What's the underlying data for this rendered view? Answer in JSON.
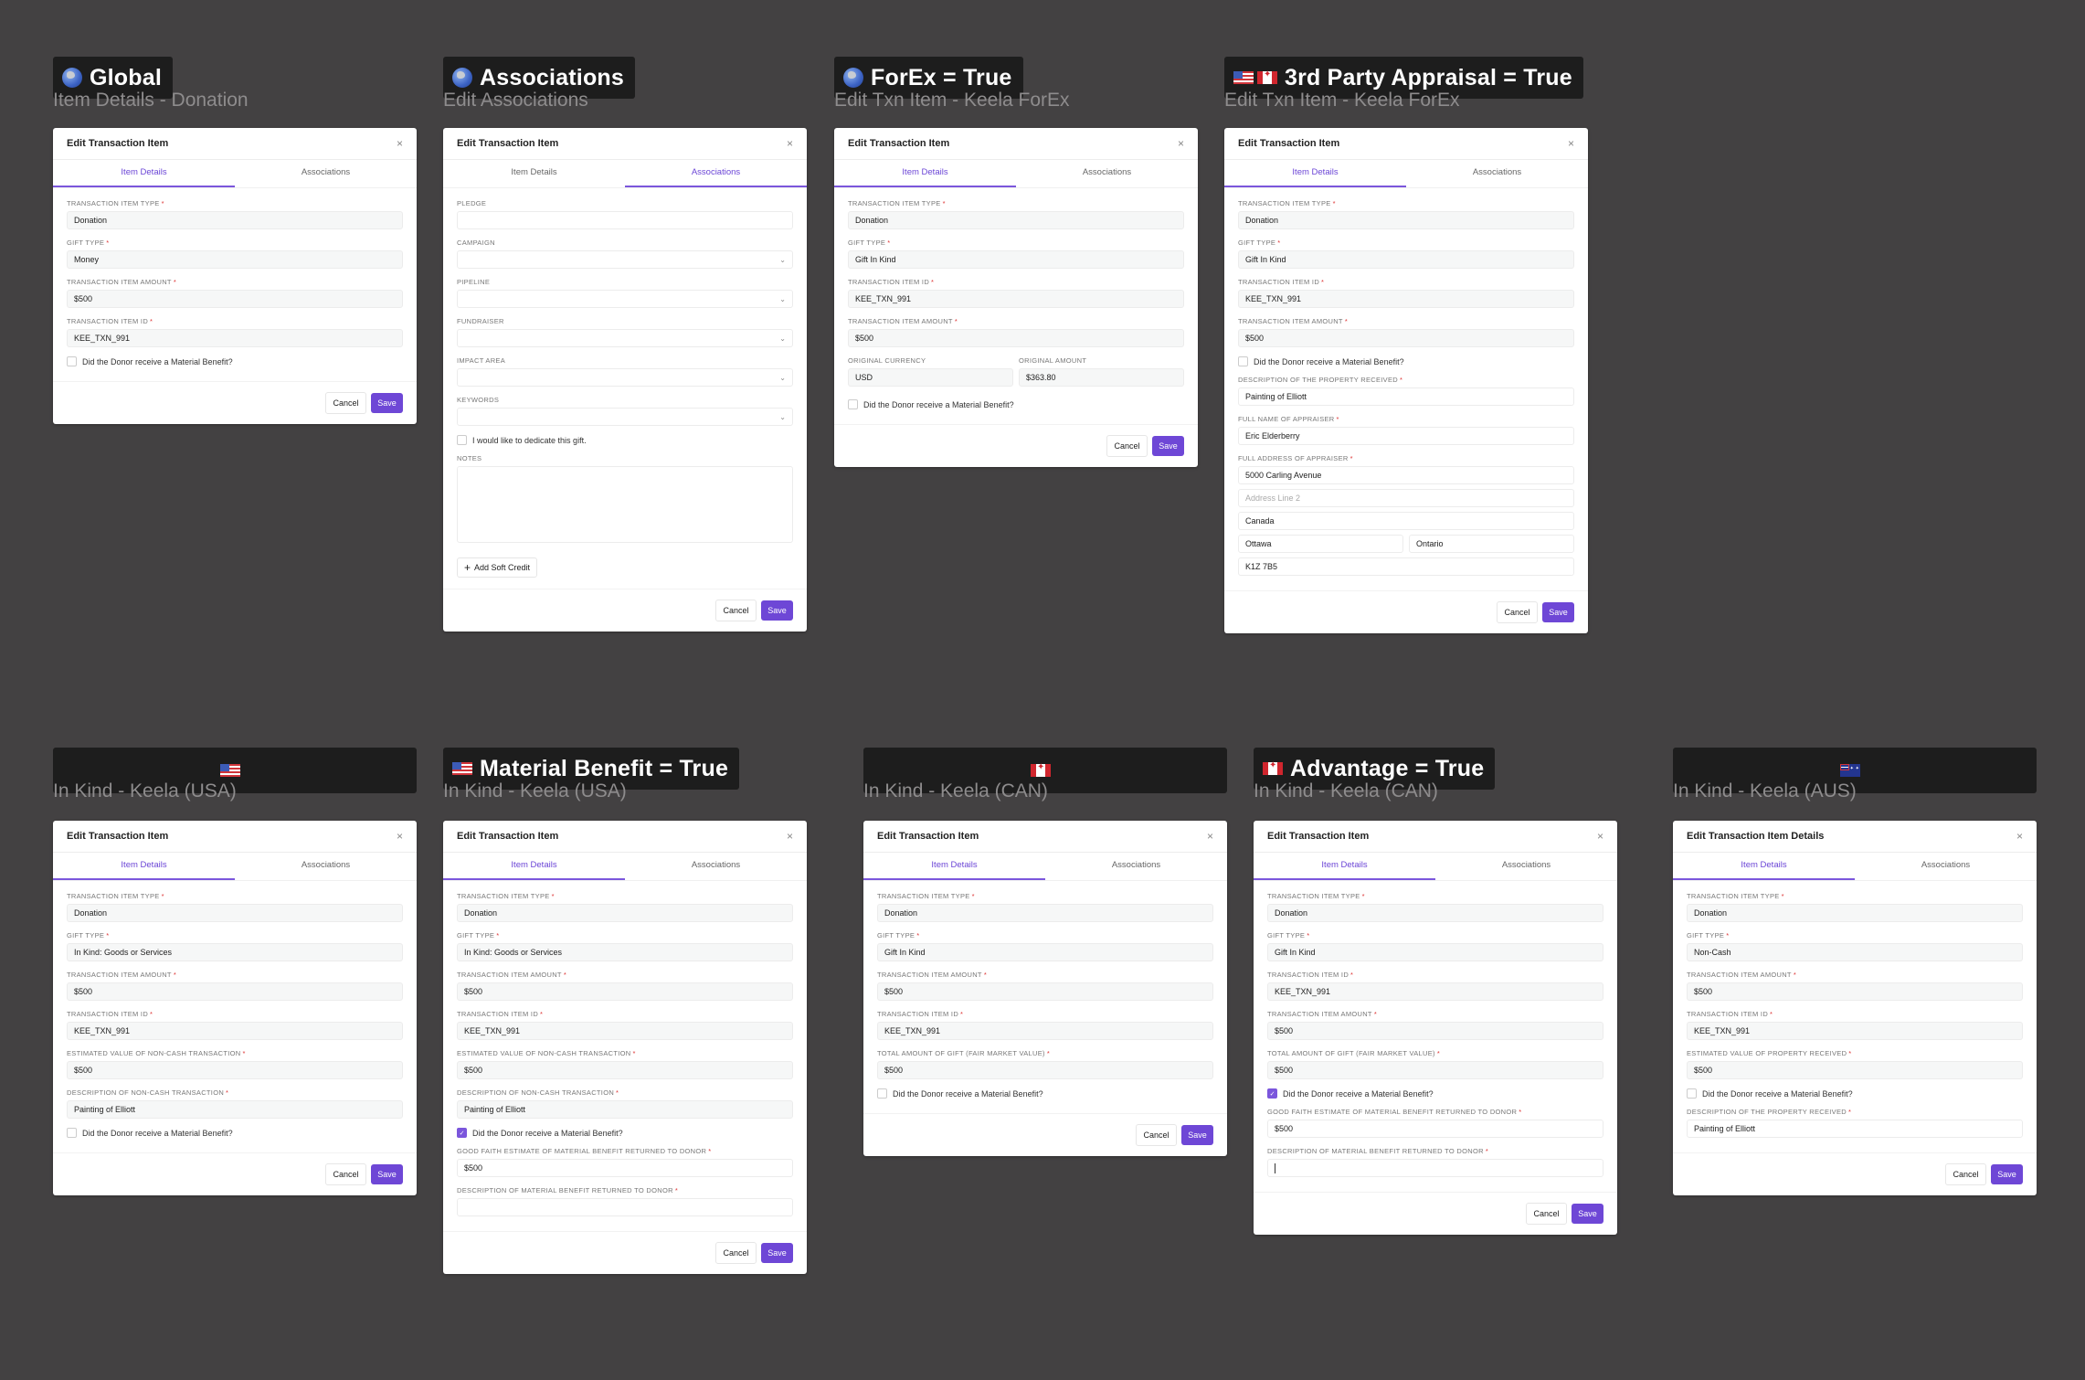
{
  "colors": {
    "background": "#434142",
    "accent": "#6e47d6",
    "required": "#d33333",
    "tag_bg": "#1d1d1d"
  },
  "common": {
    "dialog_title": "Edit Transaction Item",
    "tab_item_details": "Item Details",
    "tab_associations": "Associations",
    "cancel_label": "Cancel",
    "save_label": "Save",
    "material_benefit_label": "Did the Donor receive a Material Benefit?",
    "close_icon": "×"
  },
  "cards": [
    {
      "tag": "Global",
      "flags": [
        "globe-icon"
      ],
      "subtitle": "Item Details - Donation",
      "dialog_title": "Edit Transaction Item",
      "active_tab": "item_details",
      "fields": [
        {
          "label": "Transaction Item Type",
          "required": true,
          "value": "Donation"
        },
        {
          "label": "Gift Type",
          "required": true,
          "value": "Money"
        },
        {
          "label": "Transaction Item Amount",
          "required": true,
          "value": "$500"
        },
        {
          "label": "Transaction Item ID",
          "required": true,
          "value": "KEE_TXN_991"
        },
        {
          "type": "checkbox",
          "label": "Did the Donor receive a Material Benefit?",
          "checked": false
        }
      ]
    },
    {
      "tag": "Associations",
      "flags": [
        "globe-icon"
      ],
      "subtitle": "Edit Associations",
      "dialog_title": "Edit Transaction Item",
      "active_tab": "associations",
      "fields": [
        {
          "label": "Pledge",
          "required": false,
          "value": "",
          "white": true
        },
        {
          "label": "Campaign",
          "required": false,
          "value": "",
          "white": true,
          "select": true
        },
        {
          "label": "Pipeline",
          "required": false,
          "value": "",
          "white": true,
          "select": true
        },
        {
          "label": "Fundraiser",
          "required": false,
          "value": "",
          "white": true,
          "select": true
        },
        {
          "label": "Impact Area",
          "required": false,
          "value": "",
          "white": true,
          "select": true
        },
        {
          "label": "Keywords",
          "required": false,
          "value": "",
          "white": true,
          "select": true
        },
        {
          "type": "checkbox",
          "label": "I would like to dedicate this gift.",
          "checked": false
        },
        {
          "type": "textarea",
          "label": "Notes",
          "value": ""
        },
        {
          "type": "button",
          "label": "Add Soft Credit",
          "icon": "+"
        }
      ]
    },
    {
      "tag": "ForEx = True",
      "flags": [
        "globe-icon"
      ],
      "subtitle": "Edit Txn Item - Keela ForEx",
      "dialog_title": "Edit Transaction Item",
      "active_tab": "item_details",
      "fields": [
        {
          "label": "Transaction Item Type",
          "required": true,
          "value": "Donation"
        },
        {
          "label": "Gift Type",
          "required": true,
          "value": "Gift In Kind"
        },
        {
          "label": "Transaction Item ID",
          "required": true,
          "value": "KEE_TXN_991"
        },
        {
          "label": "Transaction Item Amount",
          "required": true,
          "value": "$500"
        },
        {
          "type": "pair",
          "items": [
            {
              "label": "Original Currency",
              "required": false,
              "value": "USD"
            },
            {
              "label": "Original Amount",
              "required": false,
              "value": "$363.80"
            }
          ]
        },
        {
          "type": "checkbox",
          "label": "Did the Donor receive a Material Benefit?",
          "checked": false
        }
      ]
    },
    {
      "tag": "3rd Party Appraisal = True",
      "flags": [
        "us-flag-icon",
        "canada-flag-icon"
      ],
      "subtitle": "Edit Txn Item - Keela ForEx",
      "dialog_title": "Edit Transaction Item",
      "active_tab": "item_details",
      "fields": [
        {
          "label": "Transaction Item Type",
          "required": true,
          "value": "Donation"
        },
        {
          "label": "Gift Type",
          "required": true,
          "value": "Gift In Kind"
        },
        {
          "label": "Transaction Item ID",
          "required": true,
          "value": "KEE_TXN_991"
        },
        {
          "label": "Transaction Item Amount",
          "required": true,
          "value": "$500"
        },
        {
          "type": "checkbox",
          "label": "Did the Donor receive a Material Benefit?",
          "checked": false
        },
        {
          "label": "Description of the Property Received",
          "required": true,
          "value": "Painting of Elliott",
          "white": true
        },
        {
          "label": "Full Name of Appraiser",
          "required": true,
          "value": "Eric Elderberry",
          "white": true
        },
        {
          "type": "address",
          "label": "Full Address of Appraiser",
          "required": true,
          "line1": "5000 Carling Avenue",
          "line2": "",
          "line2_placeholder": "Address Line 2",
          "country": "Canada",
          "city": "Ottawa",
          "province": "Ontario",
          "postal": "K1Z 7B5"
        }
      ]
    },
    {
      "tag": "",
      "flags": [
        "us-flag-icon"
      ],
      "subtitle": "In Kind - Keela (USA)",
      "dialog_title": "Edit Transaction Item",
      "active_tab": "item_details",
      "fields": [
        {
          "label": "Transaction Item Type",
          "required": true,
          "value": "Donation"
        },
        {
          "label": "Gift Type",
          "required": true,
          "value": "In Kind: Goods or Services"
        },
        {
          "label": "Transaction Item Amount",
          "required": true,
          "value": "$500"
        },
        {
          "label": "Transaction Item ID",
          "required": true,
          "value": "KEE_TXN_991"
        },
        {
          "label": "Estimated Value of Non-Cash Transaction",
          "required": true,
          "value": "$500"
        },
        {
          "label": "Description of Non-Cash Transaction",
          "required": true,
          "value": "Painting of Elliott"
        },
        {
          "type": "checkbox",
          "label": "Did the Donor receive a Material Benefit?",
          "checked": false
        }
      ]
    },
    {
      "tag": "Material Benefit = True",
      "flags": [
        "us-flag-icon"
      ],
      "subtitle": "In Kind - Keela (USA)",
      "dialog_title": "Edit Transaction Item",
      "active_tab": "item_details",
      "fields": [
        {
          "label": "Transaction Item Type",
          "required": true,
          "value": "Donation"
        },
        {
          "label": "Gift Type",
          "required": true,
          "value": "In Kind: Goods or Services"
        },
        {
          "label": "Transaction Item Amount",
          "required": true,
          "value": "$500"
        },
        {
          "label": "Transaction Item ID",
          "required": true,
          "value": "KEE_TXN_991"
        },
        {
          "label": "Estimated Value of Non-Cash Transaction",
          "required": true,
          "value": "$500"
        },
        {
          "label": "Description of Non-Cash Transaction",
          "required": true,
          "value": "Painting of Elliott"
        },
        {
          "type": "checkbox",
          "label": "Did the Donor receive a Material Benefit?",
          "checked": true
        },
        {
          "label": "Good Faith Estimate of Material Benefit Returned to Donor",
          "required": true,
          "value": "$500",
          "white": true
        },
        {
          "label": "Description of Material Benefit Returned to Donor",
          "required": true,
          "value": "",
          "white": true
        }
      ]
    },
    {
      "tag": "",
      "flags": [
        "canada-flag-icon"
      ],
      "subtitle": "In Kind - Keela (CAN)",
      "dialog_title": "Edit Transaction Item",
      "active_tab": "item_details",
      "fields": [
        {
          "label": "Transaction Item Type",
          "required": true,
          "value": "Donation"
        },
        {
          "label": "Gift Type",
          "required": true,
          "value": "Gift In Kind"
        },
        {
          "label": "Transaction Item Amount",
          "required": true,
          "value": "$500"
        },
        {
          "label": "Transaction Item ID",
          "required": true,
          "value": "KEE_TXN_991"
        },
        {
          "label": "Total Amount of Gift (Fair Market Value)",
          "required": true,
          "value": "$500"
        },
        {
          "type": "checkbox",
          "label": "Did the Donor receive a Material Benefit?",
          "checked": false
        }
      ]
    },
    {
      "tag": "Advantage = True",
      "flags": [
        "canada-flag-icon"
      ],
      "subtitle": "In Kind - Keela (CAN)",
      "dialog_title": "Edit Transaction Item",
      "active_tab": "item_details",
      "fields": [
        {
          "label": "Transaction Item Type",
          "required": true,
          "value": "Donation"
        },
        {
          "label": "Gift Type",
          "required": true,
          "value": "Gift In Kind"
        },
        {
          "label": "Transaction Item ID",
          "required": true,
          "value": "KEE_TXN_991"
        },
        {
          "label": "Transaction Item Amount",
          "required": true,
          "value": "$500"
        },
        {
          "label": "Total Amount of Gift (Fair Market Value)",
          "required": true,
          "value": "$500"
        },
        {
          "type": "checkbox",
          "label": "Did the Donor receive a Material Benefit?",
          "checked": true
        },
        {
          "label": "Good Faith Estimate of Material Benefit Returned to Donor",
          "required": true,
          "value": "$500",
          "white": true
        },
        {
          "label": "Description of Material Benefit Returned to Donor",
          "required": true,
          "value": "",
          "white": true,
          "focused": true
        }
      ]
    },
    {
      "tag": "",
      "flags": [
        "australia-flag-icon"
      ],
      "subtitle": "In Kind - Keela (AUS)",
      "dialog_title": "Edit Transaction Item Details",
      "active_tab": "item_details",
      "fields": [
        {
          "label": "Transaction Item Type",
          "required": true,
          "value": "Donation"
        },
        {
          "label": "Gift Type",
          "required": true,
          "value": "Non-Cash"
        },
        {
          "label": "Transaction Item Amount",
          "required": true,
          "value": "$500"
        },
        {
          "label": "Transaction Item ID",
          "required": true,
          "value": "KEE_TXN_991"
        },
        {
          "label": "Estimated Value of Property Received",
          "required": true,
          "value": "$500"
        },
        {
          "type": "checkbox",
          "label": "Did the Donor receive a Material Benefit?",
          "checked": false
        },
        {
          "label": "Description of the Property Received",
          "required": true,
          "value": "Painting of Elliott",
          "white": true
        }
      ]
    }
  ]
}
